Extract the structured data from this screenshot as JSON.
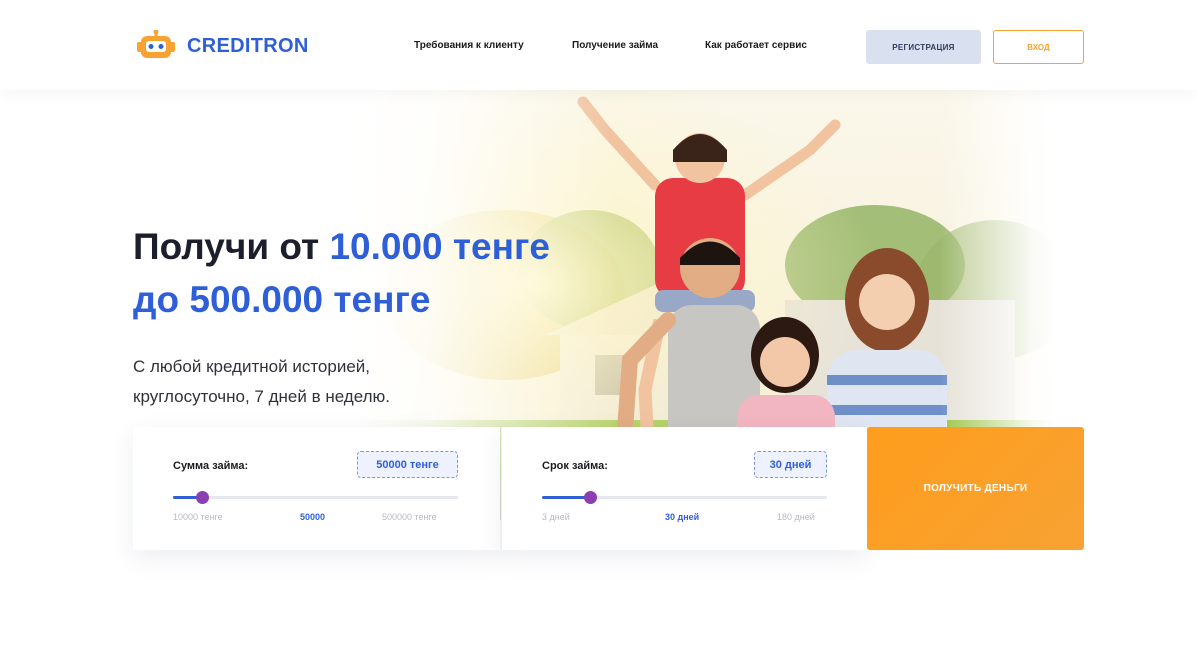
{
  "brand": {
    "name": "CREDITRON",
    "logo_icon": "robot-icon",
    "accent": "#2f5fd8",
    "orange": "#f7a233"
  },
  "nav": {
    "items": [
      "Требования к клиенту",
      "Получение займа",
      "Как работает сервис"
    ],
    "register_label": "РЕГИСТРАЦИЯ",
    "login_label": "ВХОД"
  },
  "hero": {
    "headline_part1": "Получи от ",
    "headline_amount1": "10.000 тенге",
    "headline_amount2": "до 500.000 тенге",
    "subline_1": "С любой кредитной историей,",
    "subline_2": "круглосуточно, 7 дней в неделю."
  },
  "calculator": {
    "sum": {
      "label": "Сумма займа:",
      "value": "50000 тенге",
      "min_label": "10000 тенге",
      "current_label": "50000",
      "max_label": "500000 тенге",
      "fraction": 0.1
    },
    "term": {
      "label": "Срок займа:",
      "value": "30 дней",
      "min_label": "3 дней",
      "current_label": "30 дней",
      "max_label": "180 дней",
      "fraction": 0.17
    },
    "cta_label": "ПОЛУЧИТЬ ДЕНЬГИ"
  }
}
